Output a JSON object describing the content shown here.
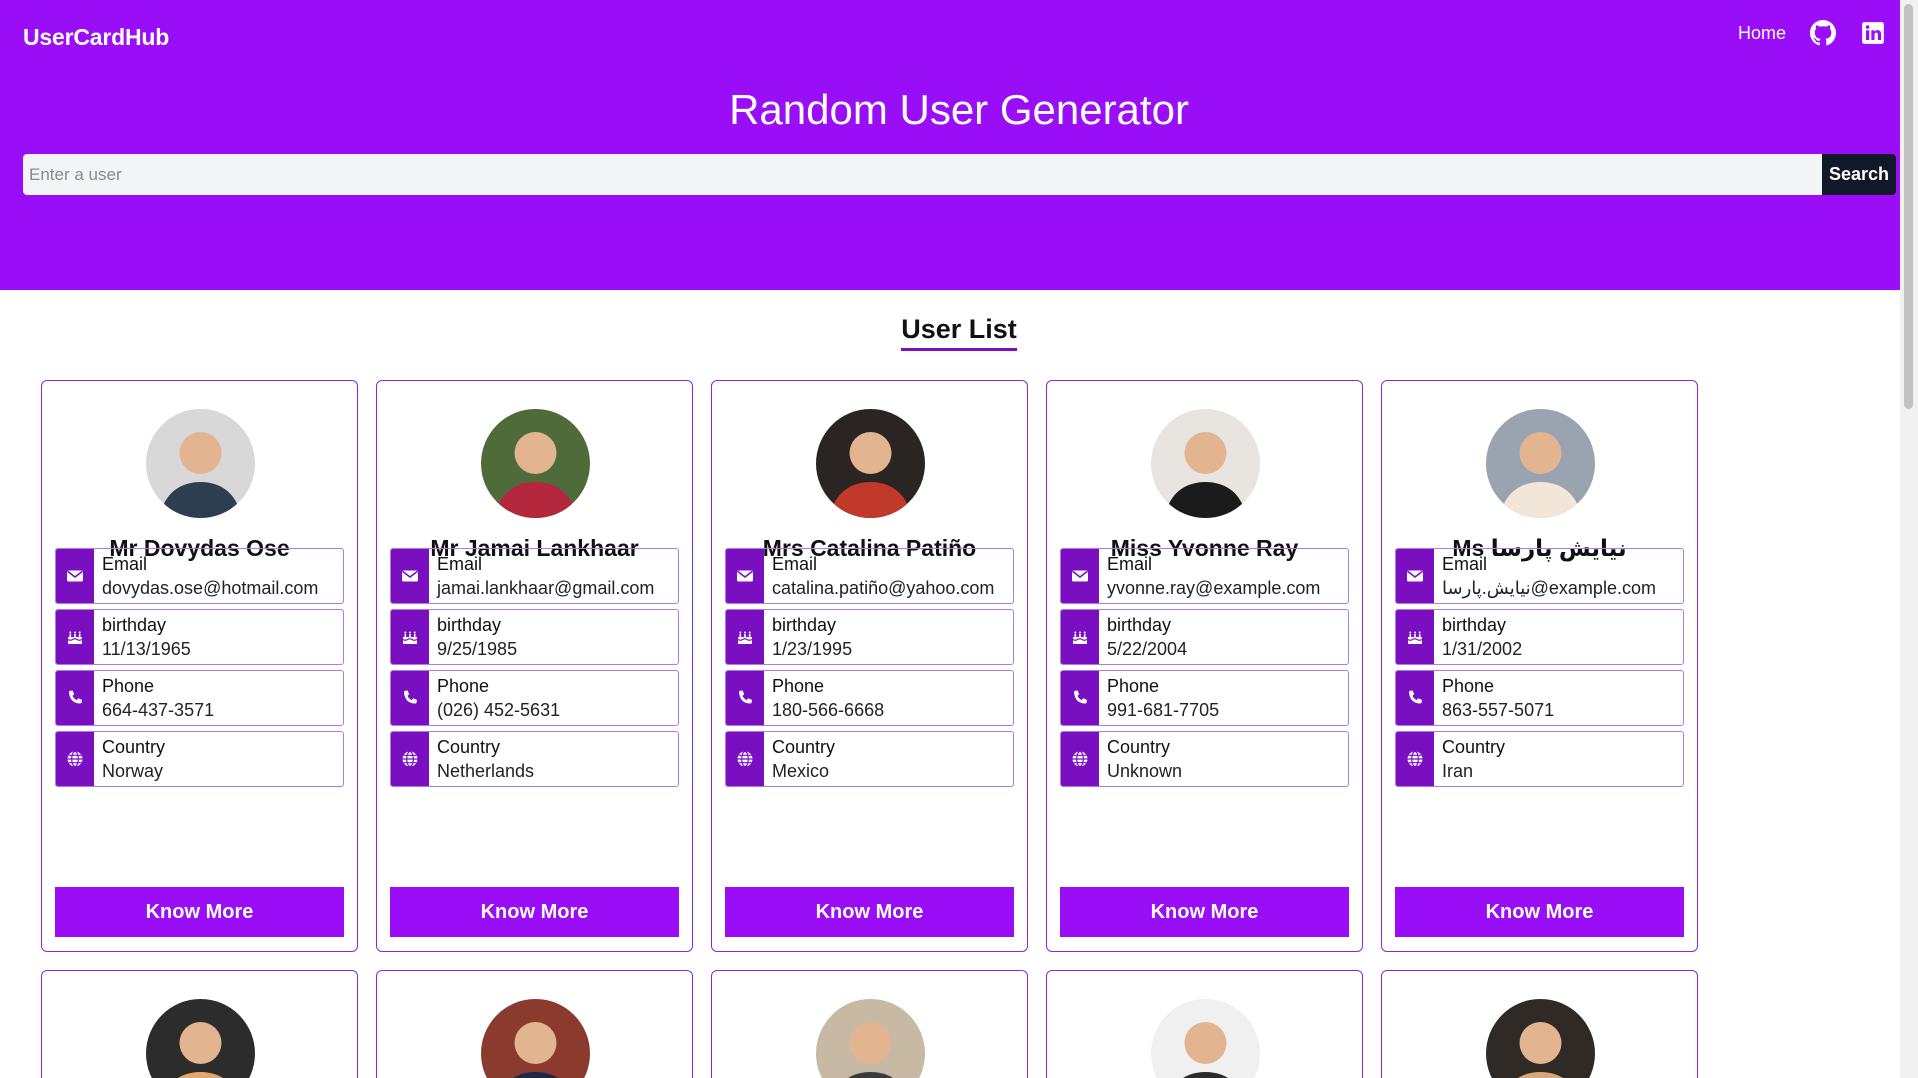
{
  "header": {
    "brand": "UserCardHub",
    "nav": {
      "home_label": "Home",
      "github_icon": "github-icon",
      "linkedin_icon": "linkedin-icon"
    },
    "title": "Random User Generator",
    "search": {
      "placeholder": "Enter a user",
      "button_label": "Search"
    }
  },
  "section_title": "User List",
  "labels": {
    "email": "Email",
    "birthday": "birthday",
    "phone": "Phone",
    "country": "Country",
    "know_more": "Know More"
  },
  "users": [
    {
      "name": "Mr Dovydas Ose",
      "email": "dovydas.ose@hotmail.com",
      "birthday": "11/13/1965",
      "phone": "664-437-3571",
      "country": "Norway",
      "avatar_bg": "#d8d8d8",
      "avatar_fg": "#2c3e50"
    },
    {
      "name": "Mr Jamai Lankhaar",
      "email": "jamai.lankhaar@gmail.com",
      "birthday": "9/25/1985",
      "phone": "(026) 452-5631",
      "country": "Netherlands",
      "avatar_bg": "#4f6b3a",
      "avatar_fg": "#b3263c"
    },
    {
      "name": "Mrs Catalina Patiño",
      "email": "catalina.patiño@yahoo.com",
      "birthday": "1/23/1995",
      "phone": "180-566-6668",
      "country": "Mexico",
      "avatar_bg": "#2a2422",
      "avatar_fg": "#c0392b"
    },
    {
      "name": "Miss Yvonne Ray",
      "email": "yvonne.ray@example.com",
      "birthday": "5/22/2004",
      "phone": "991-681-7705",
      "country": "Unknown",
      "avatar_bg": "#e8e4e0",
      "avatar_fg": "#1b1b1b"
    },
    {
      "name": "Ms نیایش پارسا",
      "email": "نیایش.پارسا@example.com",
      "birthday": "1/31/2002",
      "phone": "863-557-5071",
      "country": "Iran",
      "avatar_bg": "#9aa3b0",
      "avatar_fg": "#f2e6d8"
    }
  ],
  "users_partial": [
    {
      "avatar_bg": "#2c2c2c",
      "avatar_fg": "#e0a86b"
    },
    {
      "avatar_bg": "#8a3b2e",
      "avatar_fg": "#1e2a44"
    },
    {
      "avatar_bg": "#c7b9a3",
      "avatar_fg": "#3a3a3a"
    },
    {
      "avatar_bg": "#f0f0f0",
      "avatar_fg": "#2b2b2b"
    },
    {
      "avatar_bg": "#2f2a25",
      "avatar_fg": "#d8a77a"
    }
  ],
  "colors": {
    "primary": "#9a0ef7",
    "icon_bg": "#7a0fc2",
    "search_button": "#111827"
  },
  "icons": {
    "email": "envelope-icon",
    "birthday": "cake-icon",
    "phone": "phone-icon",
    "country": "globe-icon"
  }
}
